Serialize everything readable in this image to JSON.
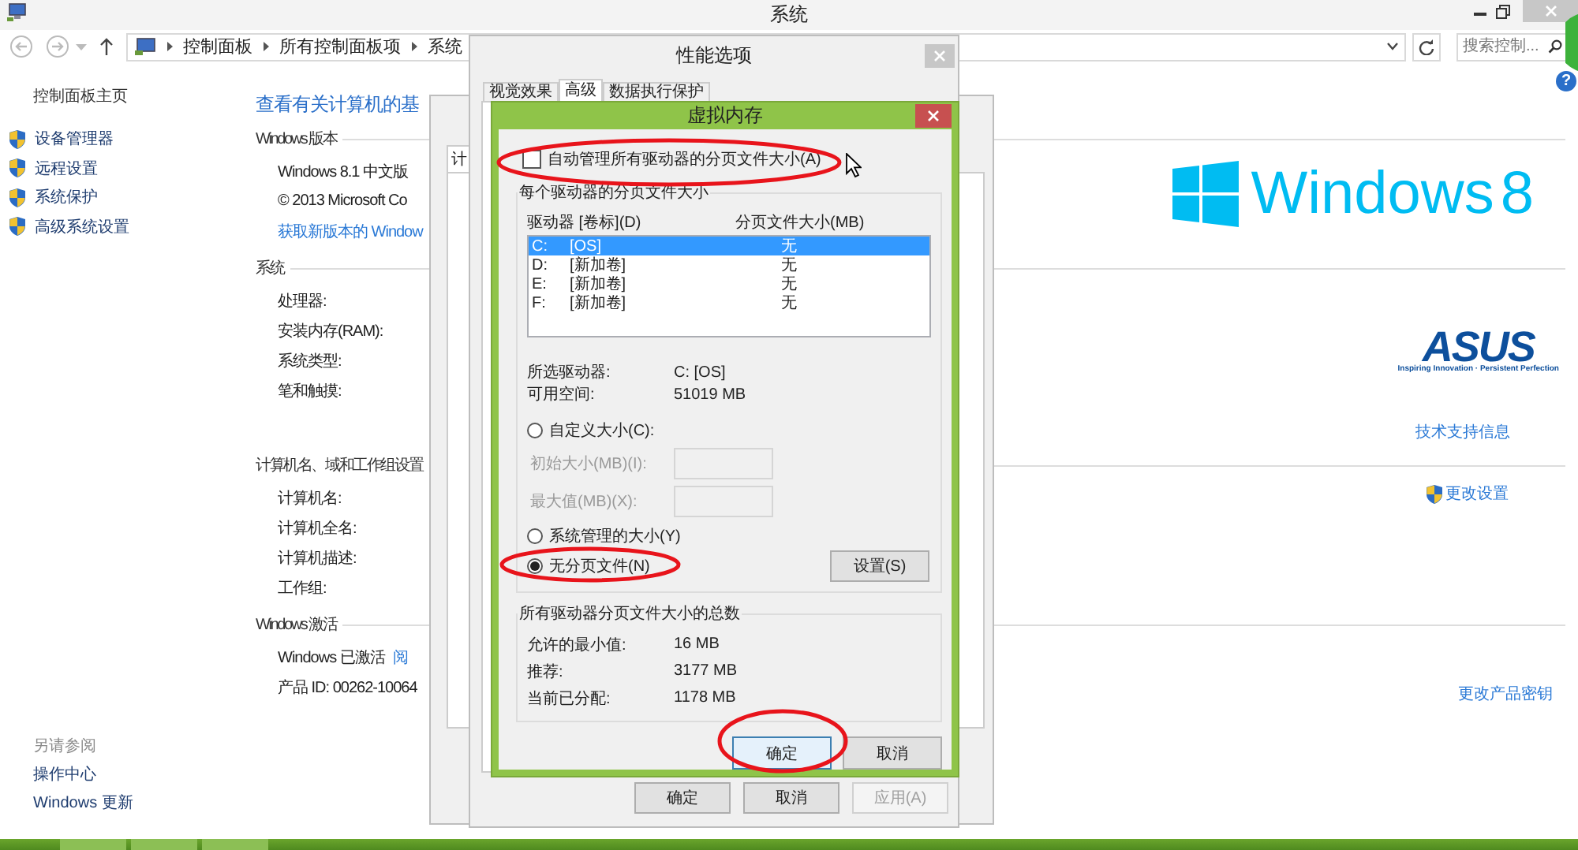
{
  "main_window": {
    "title": "系统",
    "breadcrumbs": [
      "控制面板",
      "所有控制面板项",
      "系统"
    ],
    "search": {
      "placeholder": "搜索控制..."
    },
    "help": "?",
    "sidebar": {
      "home_link": "控制面板主页",
      "items": [
        {
          "label": "设备管理器"
        },
        {
          "label": "远程设置"
        },
        {
          "label": "系统保护"
        },
        {
          "label": "高级系统设置"
        }
      ],
      "see_also": {
        "heading": "另请参阅",
        "links": [
          "操作中心",
          "Windows 更新"
        ]
      }
    },
    "heading": "查看有关计算机的基",
    "sections": [
      {
        "title": "Windows 版本",
        "rows": [
          {
            "kind": "text",
            "text": "Windows 8.1 中文版"
          },
          {
            "kind": "text",
            "text": "© 2013 Microsoft Co"
          },
          {
            "kind": "link",
            "text": "获取新版本的 Window"
          }
        ],
        "aside": {
          "kind": "windows_logo",
          "wordmark": "Windows",
          "version": "8"
        }
      },
      {
        "title": "系统",
        "rows": [
          {
            "kind": "text",
            "text": "处理器:"
          },
          {
            "kind": "text",
            "text": "安装内存(RAM):"
          },
          {
            "kind": "text",
            "text": "系统类型:"
          },
          {
            "kind": "text",
            "text": "笔和触摸:"
          }
        ],
        "aside": {
          "kind": "asus_logo",
          "wordmark": "ASUS",
          "tagline": "Inspiring Innovation · Persistent Perfection",
          "link": "技术支持信息"
        }
      },
      {
        "title": "计算机名、域和工作组设置",
        "rows": [
          {
            "kind": "text",
            "text": "计算机名:"
          },
          {
            "kind": "text",
            "text": "计算机全名:"
          },
          {
            "kind": "text",
            "text": "计算机描述:"
          },
          {
            "kind": "text",
            "text": "工作组:"
          }
        ],
        "aside": {
          "kind": "shield_link",
          "link": "更改设置"
        }
      },
      {
        "title": "Windows 激活",
        "rows": [
          {
            "kind": "text_link",
            "text": "Windows 已激活",
            "link": "阅"
          },
          {
            "kind": "text",
            "text": "产品 ID: 00262-10064"
          }
        ],
        "aside": {
          "kind": "link",
          "link": "更改产品密钥"
        }
      }
    ]
  },
  "system_properties": {
    "tab": "计"
  },
  "performance_options": {
    "title": "性能选项",
    "tabs": [
      {
        "label": "视觉效果",
        "selected": false
      },
      {
        "label": "高级",
        "selected": true
      },
      {
        "label": "数据执行保护",
        "selected": false
      }
    ],
    "buttons": [
      {
        "label": "确定",
        "disabled": false
      },
      {
        "label": "取消",
        "disabled": false
      },
      {
        "label": "应用(A)",
        "disabled": true
      }
    ]
  },
  "virtual_memory": {
    "title": "虚拟内存",
    "auto_manage": {
      "label": "自动管理所有驱动器的分页文件大小(A)",
      "checked": false
    },
    "per_drive": {
      "title": "每个驱动器的分页文件大小",
      "columns": [
        "驱动器 [卷标](D)",
        "分页文件大小(MB)"
      ],
      "drives": [
        {
          "drive": "C:",
          "label": "[OS]",
          "size": "无",
          "selected": true
        },
        {
          "drive": "D:",
          "label": "[新加卷]",
          "size": "无",
          "selected": false
        },
        {
          "drive": "E:",
          "label": "[新加卷]",
          "size": "无",
          "selected": false
        },
        {
          "drive": "F:",
          "label": "[新加卷]",
          "size": "无",
          "selected": false
        }
      ],
      "info": [
        {
          "label": "所选驱动器:",
          "value": "C:  [OS]"
        },
        {
          "label": "可用空间:",
          "value": "51019 MB"
        }
      ],
      "options": [
        {
          "kind": "radio",
          "label": "自定义大小(C):",
          "selected": false
        },
        {
          "kind": "field",
          "label": "初始大小(MB)(I):",
          "disabled": true
        },
        {
          "kind": "field",
          "label": "最大值(MB)(X):",
          "disabled": true
        },
        {
          "kind": "radio",
          "label": "系统管理的大小(Y)",
          "selected": false
        },
        {
          "kind": "radio",
          "label": "无分页文件(N)",
          "selected": true
        }
      ],
      "set_button": "设置(S)"
    },
    "totals": {
      "title": "所有驱动器分页文件大小的总数",
      "rows": [
        {
          "label": "允许的最小值:",
          "value": "16 MB"
        },
        {
          "label": "推荐:",
          "value": "3177 MB"
        },
        {
          "label": "当前已分配:",
          "value": "1178 MB"
        }
      ]
    },
    "buttons": [
      {
        "label": "确定",
        "focused": true
      },
      {
        "label": "取消",
        "focused": false
      }
    ]
  }
}
